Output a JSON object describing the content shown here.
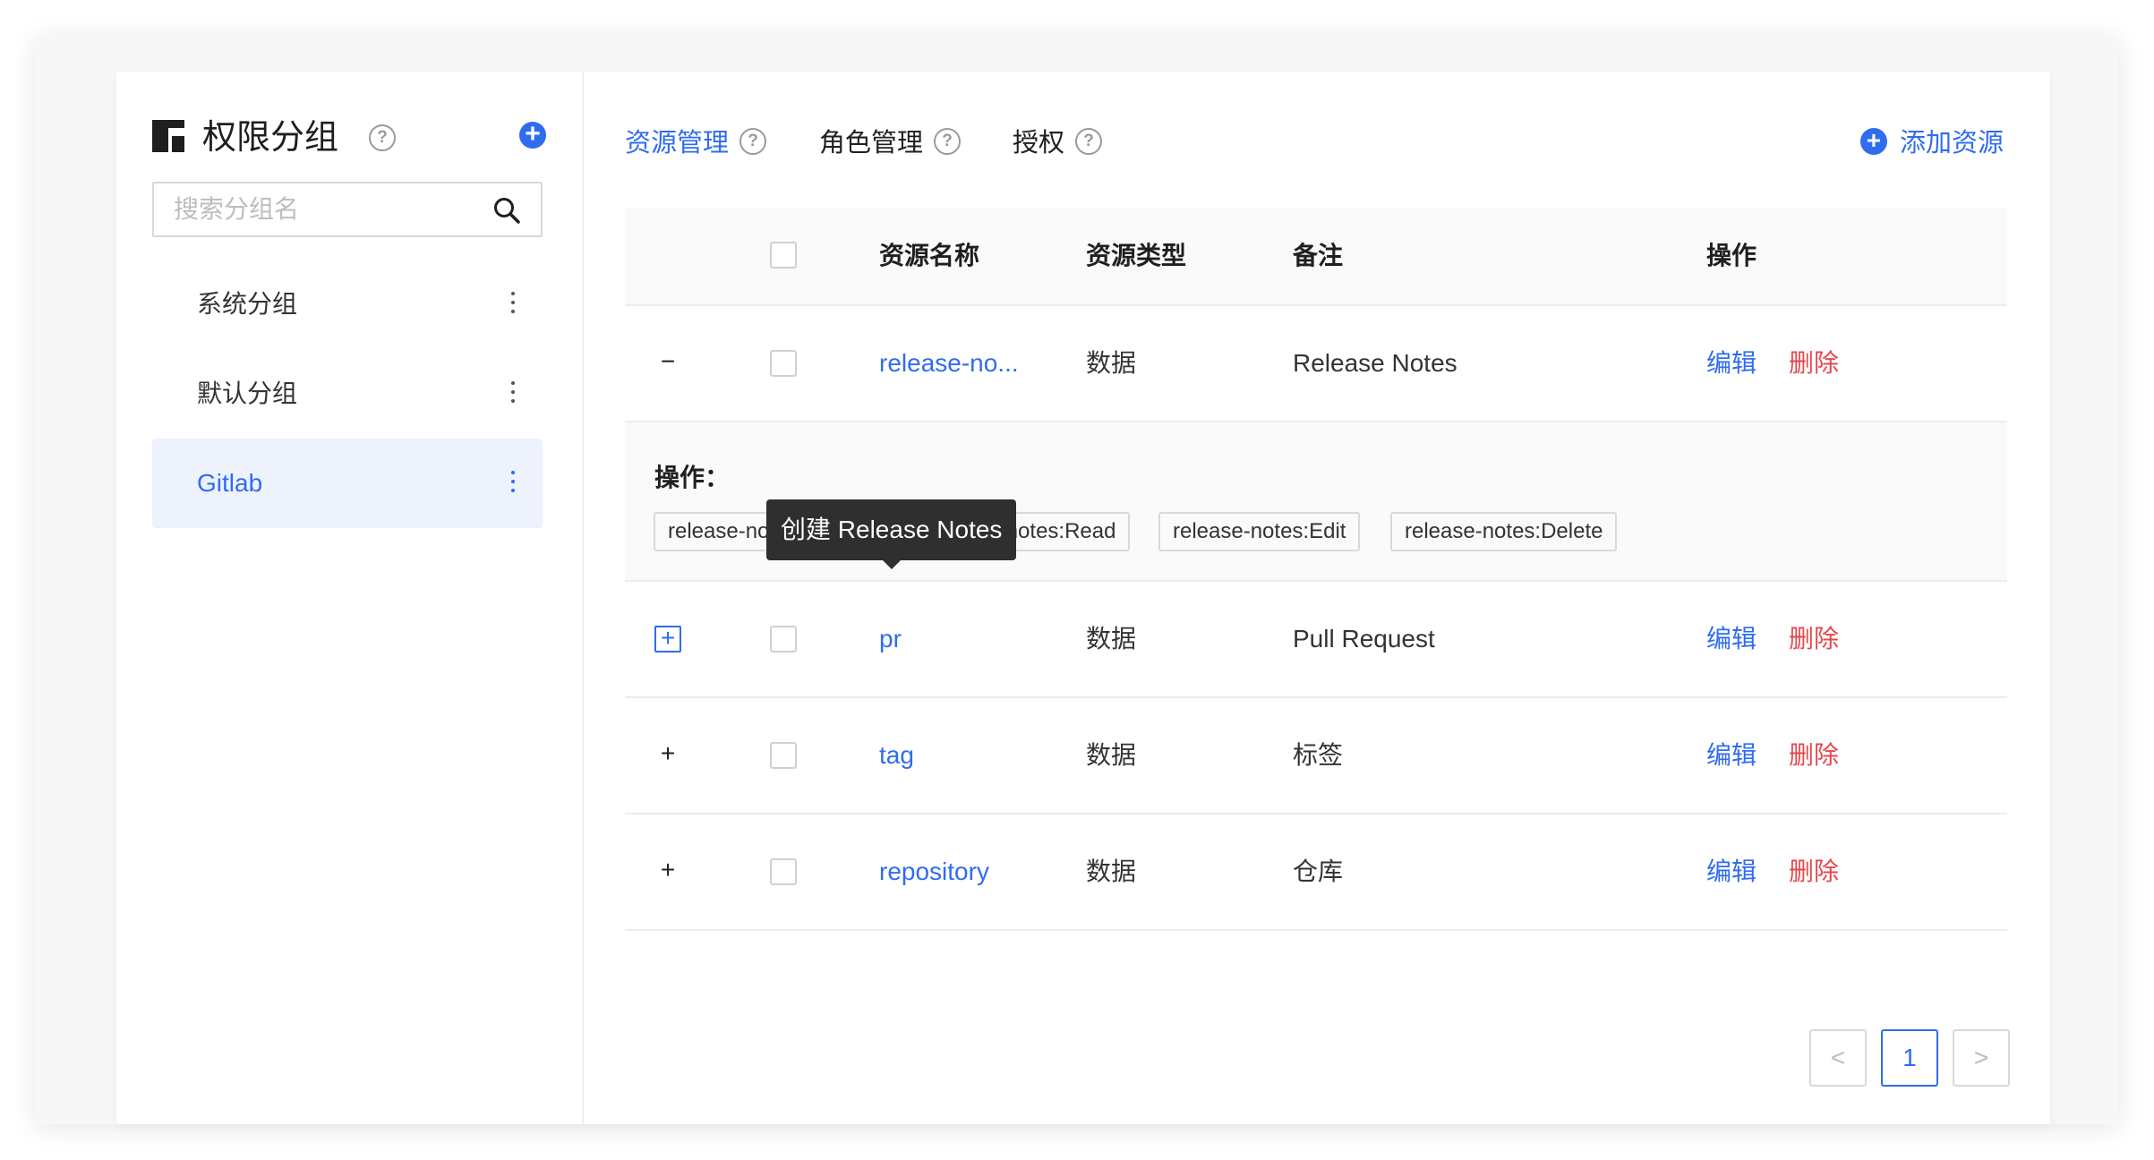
{
  "sidebar": {
    "title": "权限分组",
    "help": "?",
    "add": "+",
    "search_placeholder": "搜索分组名",
    "items": [
      {
        "label": "系统分组",
        "active": false
      },
      {
        "label": "默认分组",
        "active": false
      },
      {
        "label": "Gitlab",
        "active": true
      }
    ]
  },
  "tabs": [
    {
      "label": "资源管理",
      "active": true
    },
    {
      "label": "角色管理",
      "active": false
    },
    {
      "label": "授权",
      "active": false
    }
  ],
  "help_glyph": "?",
  "add_resource": {
    "icon": "+",
    "label": "添加资源"
  },
  "table": {
    "headers": {
      "name": "资源名称",
      "type": "资源类型",
      "note": "备注",
      "action": "操作"
    },
    "edit_label": "编辑",
    "delete_label": "删除",
    "rows": [
      {
        "expander": "−",
        "name": "release-no...",
        "type": "数据",
        "note": "Release Notes",
        "expanded": true
      },
      {
        "expander": "+",
        "name": "pr",
        "type": "数据",
        "note": "Pull Request",
        "expanded": false
      },
      {
        "expander": "+",
        "name": "tag",
        "type": "数据",
        "note": "标签",
        "expanded": false
      },
      {
        "expander": "+",
        "name": "repository",
        "type": "数据",
        "note": "仓库",
        "expanded": false
      }
    ],
    "expanded_panel": {
      "label": "操作：",
      "operations": [
        "release-notes:Create",
        "release-notes:Read",
        "release-notes:Edit",
        "release-notes:Delete"
      ]
    }
  },
  "tooltip": "创建 Release Notes",
  "pagination": {
    "prev": "<",
    "current": "1",
    "next": ">"
  },
  "colors": {
    "accent": "#2f6cf0",
    "danger": "#e5484d"
  }
}
